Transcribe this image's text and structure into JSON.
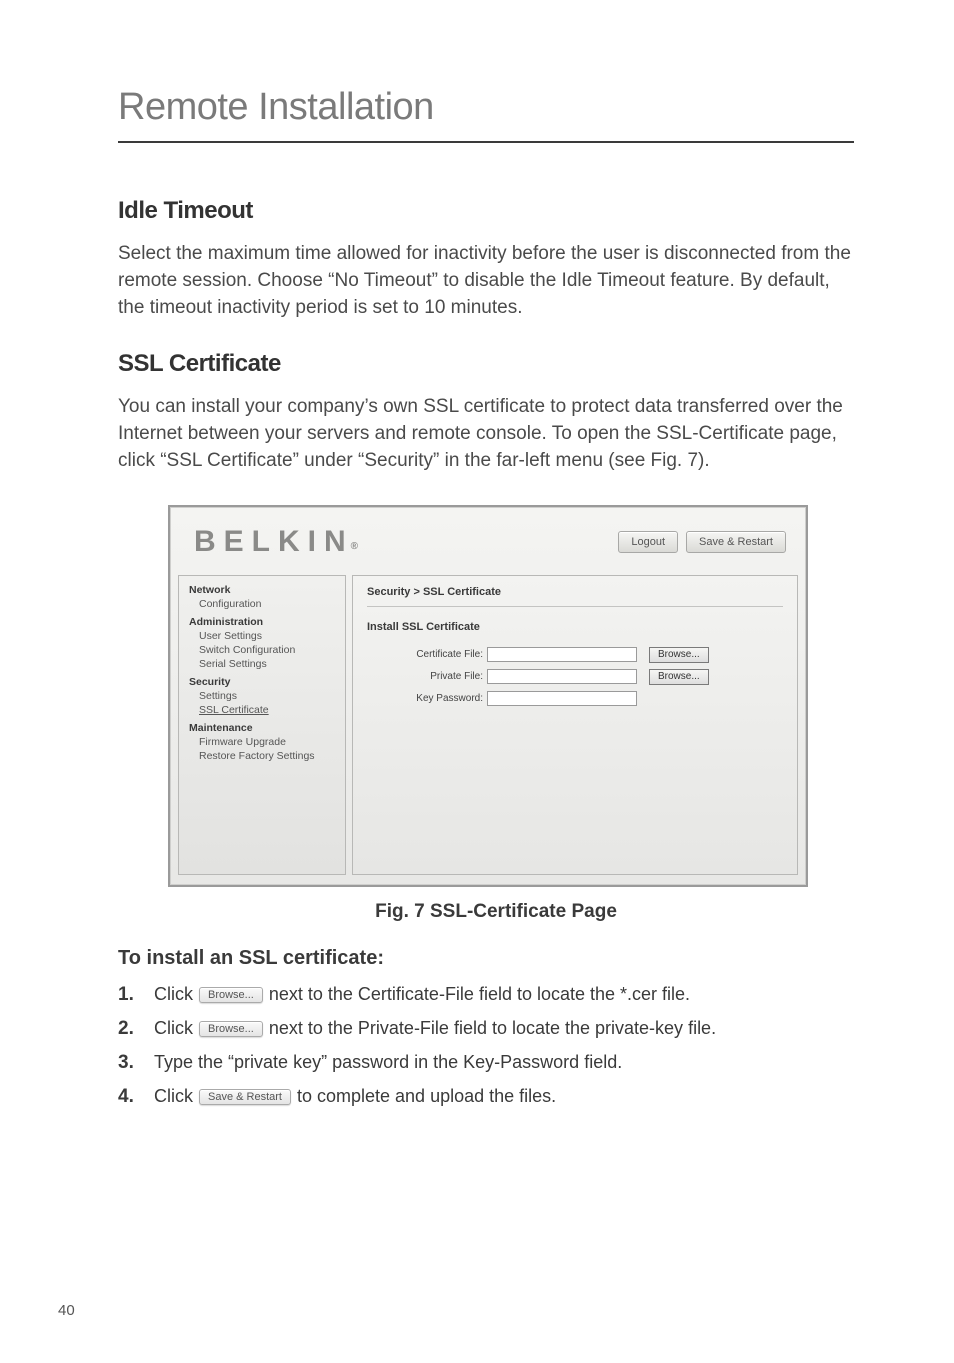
{
  "chapter_title": "Remote Installation",
  "section1": {
    "heading": "Idle Timeout",
    "body": "Select the maximum time allowed for inactivity before the user is disconnected from the remote session. Choose “No Timeout” to disable the Idle Timeout feature. By default, the timeout inactivity period is set to 10 minutes."
  },
  "section2": {
    "heading": "SSL Certificate",
    "body": "You can install your company’s own SSL certificate to protect data transferred over the Internet between your servers and remote console. To open the SSL-Certificate page, click “SSL Certificate” under “Security” in the far-left menu (see Fig. 7)."
  },
  "figure": {
    "logo": "BELKIN",
    "logo_suffix": "®",
    "top_buttons": {
      "logout": "Logout",
      "save_restart": "Save & Restart"
    },
    "sidebar": {
      "network": "Network",
      "network_items": [
        "Configuration"
      ],
      "administration": "Administration",
      "administration_items": [
        "User Settings",
        "Switch Configuration",
        "Serial Settings"
      ],
      "security": "Security",
      "security_items": [
        "Settings",
        "SSL Certificate"
      ],
      "maintenance": "Maintenance",
      "maintenance_items": [
        "Firmware Upgrade",
        "Restore Factory Settings"
      ]
    },
    "main": {
      "breadcrumb": "Security > SSL Certificate",
      "form_title": "Install SSL Certificate",
      "rows": {
        "cert_label": "Certificate File:",
        "priv_label": "Private File:",
        "key_label": "Key Password:",
        "browse": "Browse..."
      }
    },
    "caption": "Fig. 7 SSL-Certificate Page"
  },
  "install": {
    "heading": "To install an SSL certificate:",
    "steps": [
      {
        "num": "1.",
        "pre": "Click ",
        "btn": "Browse...",
        "post": " next to the Certificate-File field to locate the *.cer file."
      },
      {
        "num": "2.",
        "pre": "Click ",
        "btn": "Browse...",
        "post": " next to the Private-File field to locate the private-key file."
      },
      {
        "num": "3.",
        "pre": "Type the “private key” password in the Key-Password field.",
        "btn": null,
        "post": ""
      },
      {
        "num": "4.",
        "pre": "Click ",
        "btn": "Save & Restart",
        "post": " to complete and upload the files."
      }
    ]
  },
  "page_number": "40"
}
